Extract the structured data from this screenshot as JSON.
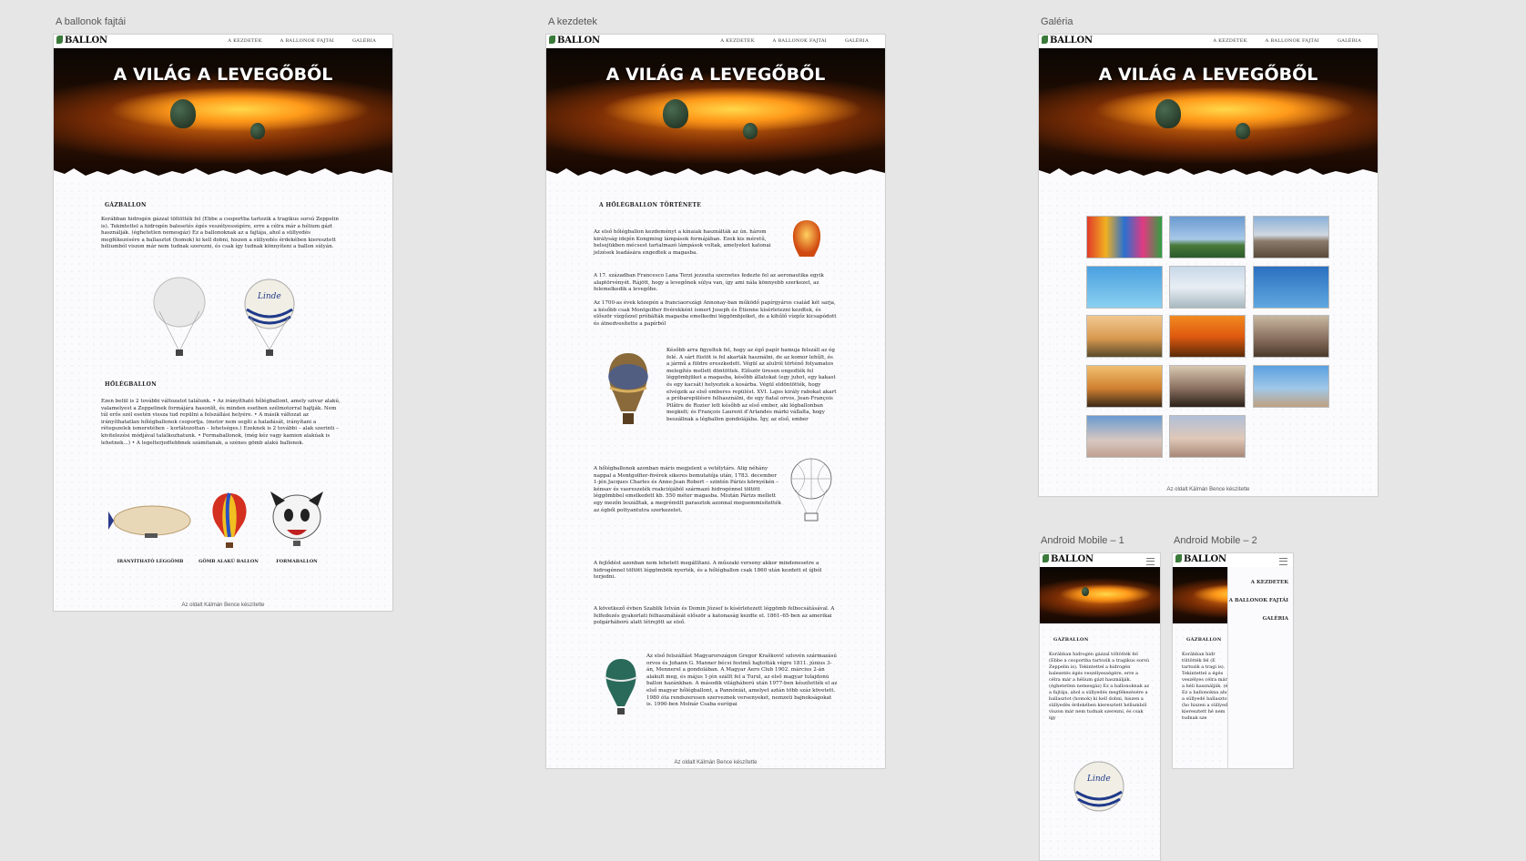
{
  "artboards": {
    "types": {
      "label": "A ballonok fajtái"
    },
    "home": {
      "label": "A kezdetek"
    },
    "gallery": {
      "label": "Galéria"
    },
    "android1": {
      "label": "Android Mobile – 1"
    },
    "android2": {
      "label": "Android Mobile – 2"
    }
  },
  "site": {
    "logo": "BALLON",
    "nav": [
      "A KEZDETEK",
      "A BALLONOK FAJTÁI",
      "GALÉRIA"
    ],
    "hero_title": "A VILÁG A LEVEGŐBŐL",
    "footer": "Az oldalt Kálmán Bence készítette"
  },
  "types_page": {
    "section1_title": "GÁZBALLON",
    "section1_text": "Korábban hidrogén gázzal töltötték fel (Ebbe a csoportba tartozik a tragikus sorsú Zeppelin is). Tekintettel a hidrogén balesetés égés veszélyességére, erre a célra már a hélium gázt használják. (éghetetlen nemesgáz) Ez a ballonoknak az a fajtája, ahol a süllyedés megfékezésére a ballasztot (homok) ki kell dobni, hiszen a süllyedés érdekében kieresztett héliumból viszon már nem tudnak szerezni, és csak így tudnak könnyíteni a ballon súlyán.",
    "section2_title": "HŐLÉGBALLON",
    "section2_text": "Ezen belül is 2 további változatot találunk. • Az irányítható hőlégballont, amely szivar alakú, valamelyest a Zeppelinek formájára hasonlít, és minden esetben szélmotorral hajtják. Nem túl erős szél esetén vissza tud repülni a felszállási helyére. • A másik változat az irányíthatatlan hőlégballonok csoportja. (motor nem segíti a haladását, irányítani a rétegszelek ismeretében – korlátozottan – lehetséges.) Ezeknek is 2 további – alak szerinti – kivitelezési módjával találkozhatunk. • Formaballonok, (még kéz vagy kamion alakúak is lehetnek...) • A legelterjedtebbnek számítanak, a szénes gömb alakú ballonok.",
    "captions": [
      "IRÁNYÍTHATÓ LÉGGÖMB",
      "GÖMB ALAKÚ BALLON",
      "FORMABALLON"
    ]
  },
  "home_page": {
    "section_title": "A HŐLÉGBALLON TÖRTÉNETE",
    "p1": "Az első hőlégballon kezdeményt a kínaiak használták az ún. három királyság idején Kongming lámpások formájában. Ezek kis méretű, belsejükben mécsest tartalmazó lámpások voltak, amelyeket katonai jelzések leadására engedtek a magasba.",
    "p2": "A 17. században Francesco Lana Terzi jezsuita szerzetes fedezte fel az aeronautika egyik alaptörvényét. Rájött, hogy a levegőnek súlya van, így ami nála könnyebb szerkezet, az felemelkedik a levegőbe.",
    "p3": "Az 1700-as évek közepén a franciaországi Annonay-ban működő papírgyáros család két sarja, a később csak Montgolfier fivérekként ismert Joseph és Étienne kísérletezni kezdtek, és először vízgőzzel próbálták magasba emelkedni léggömbjeiket, de a kihűlő vízgőz kicsapódott és átnedvesítette a papírból",
    "p4": "Később arra figyeltek fel, hogy az égő papír hamuja felszáll az ég felé. A sárt füstöt is fel akarták használni, de az komor lehűlt, és a jármű a földre ereszkedett. Végül az alulról történő folyamatos melegítés mellett döntöttek. Először üresen engedték fel léggömbjüket a magasba, később állatokat (egy juhot, egy kakast és egy kacsát) helyeztek a kosárba. Végül eldöntötték, hogy elvégzik az első emberes repülést. XVI. Lajos király rabokat akart a próbarepülésre felhasználni, de egy fiatal orvos, Jean-François Pilâtre de Rozier lett később az első ember, aki légballonban megkelt; és François Laurent d’Arlandes márki vállalta, hogy beszállnak a légballon gondolájába. Így, az első, ember",
    "p5": "A hőlégballonok azonban máris megjelent a vetélytárs. Alig néhány nappal a Montgolfier-fivérek sikeres bemutatója után, 1783. december 1-jén Jacques Charles és Anne-Jean Robert – szintén Párizs környékén – kénsav és vasreszelék reakciójából származó hidrogénnel töltött léggömbbel emelkedett kb. 550 méter magasba. Miután Párizs mellett egy mezőn leszálltak, a megrémült parasztok azonnal megsemmisítették az égből pottyantutra szerkezetet.",
    "p6": "A fejlődést azonban nem lehetett megállítani. A műszaki verseny akkor mindenesetre a hidrogénnel töltött léggömbök nyerték, és a hőlégballon csak 1860 után kezdett el újból terjedni.",
    "p7": "A következő évben Szablik István és Domin József is kísérletezett léggömb felbocsátásával. A felfedezés gyakorlati felhasználását először a katonaság kezdte el. 1861–65-ben az amerikai polgárháború alatt létrejött az első.",
    "p8": "Az első felszállást Magyarországon Gregor Kraškovič szlovén származású orvos és Johann G. Manner bécsi festmű hajtották végre 1811. június 3-án, Mennerel a gondolában. A Magyar Aero Club 1902. március 2-án alakult meg, és május 1-jén szállt fel a Turul, az első magyar tulajdonú ballon hazánkban. A második világháború után 1977-ben készítették el az első magyar hőlégballont, a Pannóniát, amelyet aztán több száz követett. 1980 óta rendszeresen szerveznek versenyeket, nemzeti bajnokságokat is. 1990-ben Molnár Csaba európai"
  },
  "mobile": {
    "section_title": "GÁZBALLON",
    "text": "Korábban hidrogén gázzal töltötték fel (Ebbe a csoportba tartozik a tragikus sorsú Zeppelin is). Tekintettel a hidrogén balesetés égés veszélyességére, erre a célra már a hélium gázt használják. (éghetetlen nemesgáz) Ez a ballonoknak az a fajtája, ahol a süllyedés megfékezésére a ballasztot (homok) ki kell dobni, hiszen a süllyedés érdekében kieresztett héliumból viszon már nem tudnak szerezni, és csak így",
    "text_clipped": "Korábban hidr töltötték fel (E tartozik a tragi is). Tekintettel a égés veszélyes célra már a héli használják. (é Ez a ballonokna ahol a süllyedé ballasztot (ho hiszen a süllyed kieresztett hé nem tudnak sze"
  },
  "icons": {
    "menu": "hamburger-icon",
    "logo": "balloon-leaf-icon"
  },
  "colors": {
    "canvas": "#e6e6e6",
    "hero_orange": "#ff9a1a",
    "text": "#222222"
  }
}
